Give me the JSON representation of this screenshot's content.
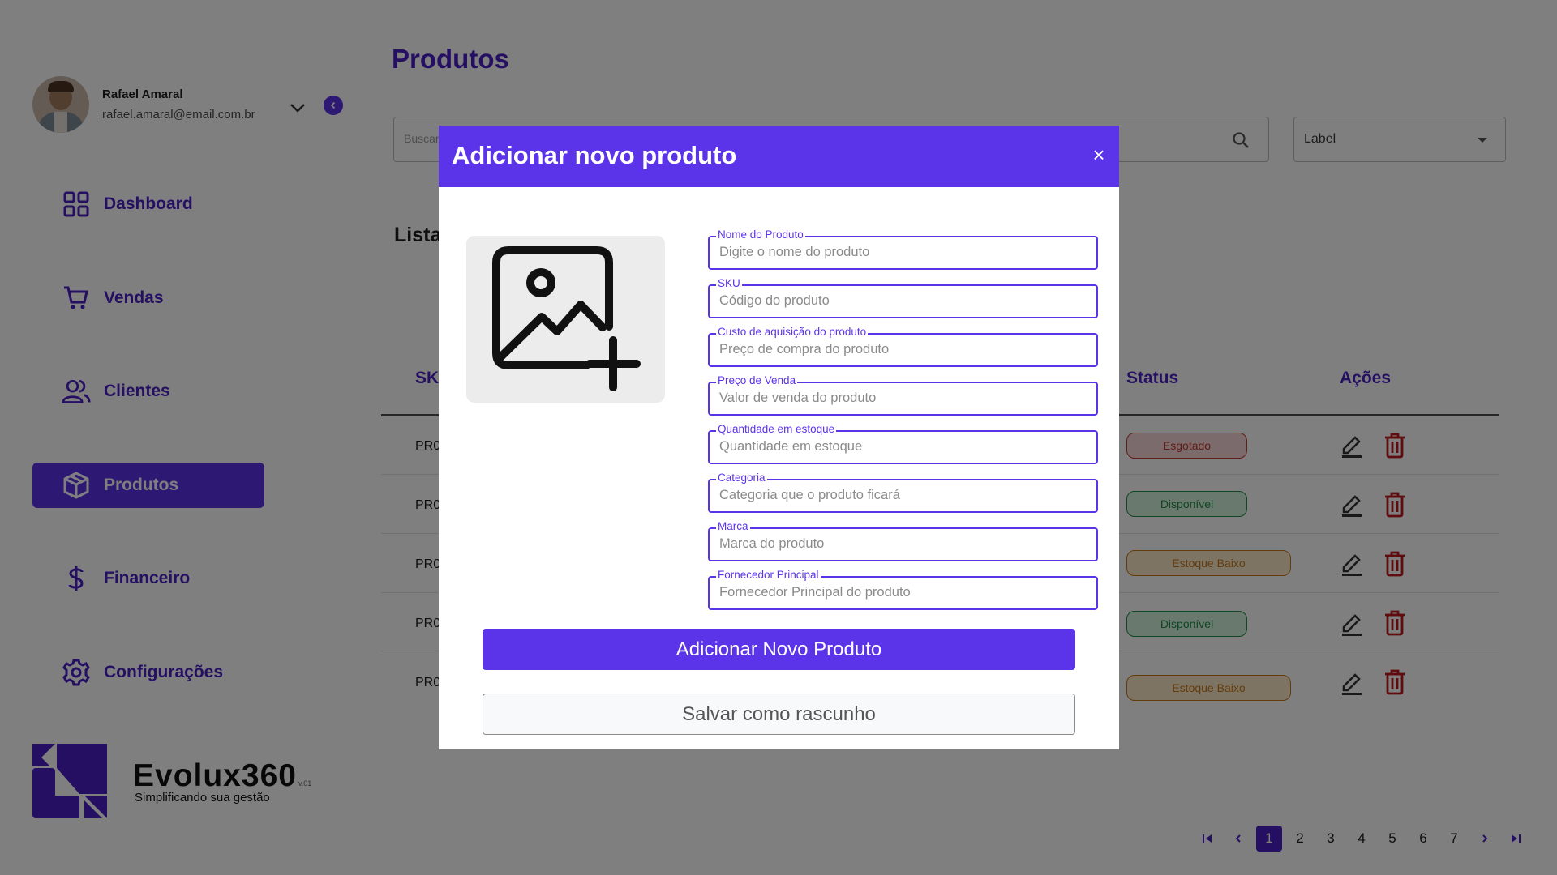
{
  "profile": {
    "name": "Rafael Amaral",
    "email": "rafael.amaral@email.com.br"
  },
  "nav": {
    "items": [
      {
        "label": "Dashboard",
        "icon": "grid-icon"
      },
      {
        "label": "Vendas",
        "icon": "cart-icon"
      },
      {
        "label": "Clientes",
        "icon": "users-icon"
      },
      {
        "label": "Produtos",
        "icon": "box-icon",
        "active": true
      },
      {
        "label": "Financeiro",
        "icon": "dollar-icon"
      },
      {
        "label": "Configurações",
        "icon": "gear-icon"
      }
    ]
  },
  "brand": {
    "name": "Evolux360",
    "version": "v.01",
    "tagline": "Simplificando sua gestão"
  },
  "page": {
    "title": "Produtos",
    "list_title": "Lista"
  },
  "search": {
    "placeholder": "Buscar"
  },
  "filter": {
    "label": "Label"
  },
  "table": {
    "headers": {
      "sku": "SKU",
      "status": "Status",
      "actions": "Ações"
    },
    "rows": [
      {
        "sku": "PR0",
        "status": "Esgotado"
      },
      {
        "sku": "PR0",
        "status": "Disponível"
      },
      {
        "sku": "PR0",
        "status": "Estoque Baixo"
      },
      {
        "sku": "PR0",
        "status": "Disponível"
      },
      {
        "sku": "PR0",
        "status": "Estoque Baixo"
      }
    ]
  },
  "pagination": {
    "pages": [
      "1",
      "2",
      "3",
      "4",
      "5",
      "6",
      "7"
    ],
    "current": "1"
  },
  "modal": {
    "title": "Adicionar novo produto",
    "close": "×",
    "fields": [
      {
        "label": "Nome do Produto",
        "placeholder": "Digite o nome do produto"
      },
      {
        "label": "SKU",
        "placeholder": "Código do produto"
      },
      {
        "label": "Custo de aquisição do produto",
        "placeholder": "Preço de compra do produto"
      },
      {
        "label": "Preço de Venda",
        "placeholder": "Valor de venda do produto"
      },
      {
        "label": "Quantidade em estoque",
        "placeholder": "Quantidade em estoque"
      },
      {
        "label": "Categoria",
        "placeholder": "Categoria que o produto ficará"
      },
      {
        "label": "Marca",
        "placeholder": "Marca do produto"
      },
      {
        "label": "Fornecedor Principal",
        "placeholder": "Fornecedor Principal do produto"
      }
    ],
    "primary_button": "Adicionar Novo Produto",
    "secondary_button": "Salvar como rascunho"
  },
  "colors": {
    "accent": "#5b33e8",
    "nav_text": "#4b1fc7",
    "danger": "#c0392b",
    "success": "#1e8c46",
    "warning": "#c7781b"
  }
}
